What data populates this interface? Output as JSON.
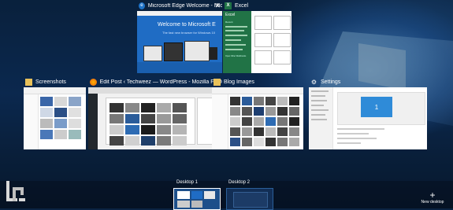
{
  "windows": [
    {
      "title": "Microsoft Edge Welcome - Micro...",
      "icon": "edge-icon",
      "heading": "Welcome to Microsoft E",
      "sub": "The fast new browser for Windows 10"
    },
    {
      "title": "Excel",
      "icon": "excel-icon",
      "app_label": "Excel",
      "recent": "Recent",
      "open": "Open Other Workbooks"
    },
    {
      "title": "Screenshots",
      "icon": "folder-icon"
    },
    {
      "title": "Edit Post ‹ Techweez — WordPress - Mozilla Firefox",
      "icon": "firefox-icon"
    },
    {
      "title": "Blog Images",
      "icon": "folder-icon"
    },
    {
      "title": "Settings",
      "icon": "gear-icon",
      "display_num": "1"
    }
  ],
  "desktops": [
    {
      "label": "Desktop 1"
    },
    {
      "label": "Desktop 2"
    }
  ],
  "new_desktop": {
    "plus": "+",
    "label": "New desktop"
  },
  "colors": {
    "accent": "#1e73c8",
    "excel": "#217346",
    "settings_blue": "#2f8bd8"
  }
}
